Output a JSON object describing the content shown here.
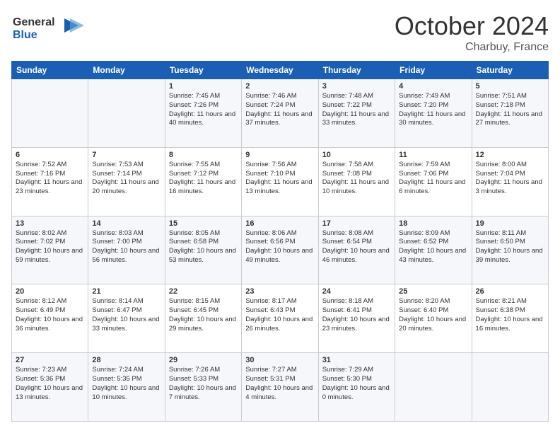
{
  "header": {
    "logo_line1": "General",
    "logo_line2": "Blue",
    "month": "October 2024",
    "location": "Charbuy, France"
  },
  "weekdays": [
    "Sunday",
    "Monday",
    "Tuesday",
    "Wednesday",
    "Thursday",
    "Friday",
    "Saturday"
  ],
  "weeks": [
    [
      {
        "day": "",
        "info": ""
      },
      {
        "day": "",
        "info": ""
      },
      {
        "day": "1",
        "info": "Sunrise: 7:45 AM\nSunset: 7:26 PM\nDaylight: 11 hours and 40 minutes."
      },
      {
        "day": "2",
        "info": "Sunrise: 7:46 AM\nSunset: 7:24 PM\nDaylight: 11 hours and 37 minutes."
      },
      {
        "day": "3",
        "info": "Sunrise: 7:48 AM\nSunset: 7:22 PM\nDaylight: 11 hours and 33 minutes."
      },
      {
        "day": "4",
        "info": "Sunrise: 7:49 AM\nSunset: 7:20 PM\nDaylight: 11 hours and 30 minutes."
      },
      {
        "day": "5",
        "info": "Sunrise: 7:51 AM\nSunset: 7:18 PM\nDaylight: 11 hours and 27 minutes."
      }
    ],
    [
      {
        "day": "6",
        "info": "Sunrise: 7:52 AM\nSunset: 7:16 PM\nDaylight: 11 hours and 23 minutes."
      },
      {
        "day": "7",
        "info": "Sunrise: 7:53 AM\nSunset: 7:14 PM\nDaylight: 11 hours and 20 minutes."
      },
      {
        "day": "8",
        "info": "Sunrise: 7:55 AM\nSunset: 7:12 PM\nDaylight: 11 hours and 16 minutes."
      },
      {
        "day": "9",
        "info": "Sunrise: 7:56 AM\nSunset: 7:10 PM\nDaylight: 11 hours and 13 minutes."
      },
      {
        "day": "10",
        "info": "Sunrise: 7:58 AM\nSunset: 7:08 PM\nDaylight: 11 hours and 10 minutes."
      },
      {
        "day": "11",
        "info": "Sunrise: 7:59 AM\nSunset: 7:06 PM\nDaylight: 11 hours and 6 minutes."
      },
      {
        "day": "12",
        "info": "Sunrise: 8:00 AM\nSunset: 7:04 PM\nDaylight: 11 hours and 3 minutes."
      }
    ],
    [
      {
        "day": "13",
        "info": "Sunrise: 8:02 AM\nSunset: 7:02 PM\nDaylight: 10 hours and 59 minutes."
      },
      {
        "day": "14",
        "info": "Sunrise: 8:03 AM\nSunset: 7:00 PM\nDaylight: 10 hours and 56 minutes."
      },
      {
        "day": "15",
        "info": "Sunrise: 8:05 AM\nSunset: 6:58 PM\nDaylight: 10 hours and 53 minutes."
      },
      {
        "day": "16",
        "info": "Sunrise: 8:06 AM\nSunset: 6:56 PM\nDaylight: 10 hours and 49 minutes."
      },
      {
        "day": "17",
        "info": "Sunrise: 8:08 AM\nSunset: 6:54 PM\nDaylight: 10 hours and 46 minutes."
      },
      {
        "day": "18",
        "info": "Sunrise: 8:09 AM\nSunset: 6:52 PM\nDaylight: 10 hours and 43 minutes."
      },
      {
        "day": "19",
        "info": "Sunrise: 8:11 AM\nSunset: 6:50 PM\nDaylight: 10 hours and 39 minutes."
      }
    ],
    [
      {
        "day": "20",
        "info": "Sunrise: 8:12 AM\nSunset: 6:49 PM\nDaylight: 10 hours and 36 minutes."
      },
      {
        "day": "21",
        "info": "Sunrise: 8:14 AM\nSunset: 6:47 PM\nDaylight: 10 hours and 33 minutes."
      },
      {
        "day": "22",
        "info": "Sunrise: 8:15 AM\nSunset: 6:45 PM\nDaylight: 10 hours and 29 minutes."
      },
      {
        "day": "23",
        "info": "Sunrise: 8:17 AM\nSunset: 6:43 PM\nDaylight: 10 hours and 26 minutes."
      },
      {
        "day": "24",
        "info": "Sunrise: 8:18 AM\nSunset: 6:41 PM\nDaylight: 10 hours and 23 minutes."
      },
      {
        "day": "25",
        "info": "Sunrise: 8:20 AM\nSunset: 6:40 PM\nDaylight: 10 hours and 20 minutes."
      },
      {
        "day": "26",
        "info": "Sunrise: 8:21 AM\nSunset: 6:38 PM\nDaylight: 10 hours and 16 minutes."
      }
    ],
    [
      {
        "day": "27",
        "info": "Sunrise: 7:23 AM\nSunset: 5:36 PM\nDaylight: 10 hours and 13 minutes."
      },
      {
        "day": "28",
        "info": "Sunrise: 7:24 AM\nSunset: 5:35 PM\nDaylight: 10 hours and 10 minutes."
      },
      {
        "day": "29",
        "info": "Sunrise: 7:26 AM\nSunset: 5:33 PM\nDaylight: 10 hours and 7 minutes."
      },
      {
        "day": "30",
        "info": "Sunrise: 7:27 AM\nSunset: 5:31 PM\nDaylight: 10 hours and 4 minutes."
      },
      {
        "day": "31",
        "info": "Sunrise: 7:29 AM\nSunset: 5:30 PM\nDaylight: 10 hours and 0 minutes."
      },
      {
        "day": "",
        "info": ""
      },
      {
        "day": "",
        "info": ""
      }
    ]
  ]
}
